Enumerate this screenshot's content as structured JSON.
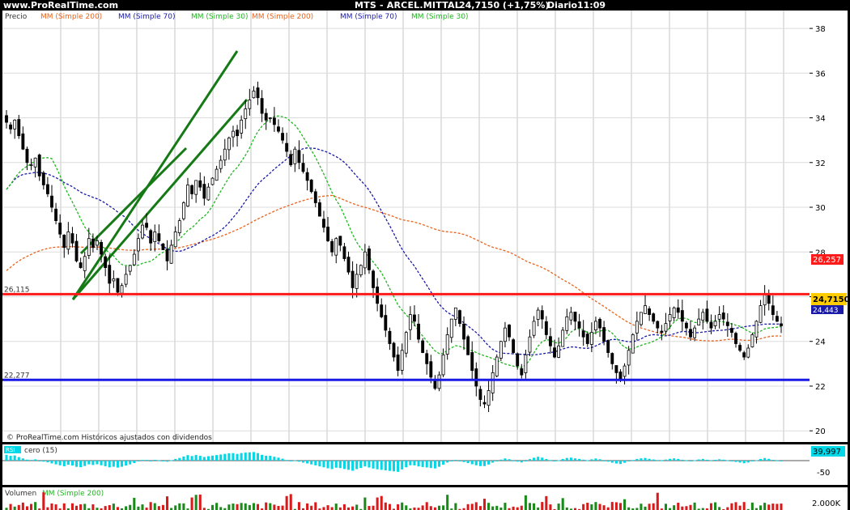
{
  "header": {
    "site": "www.ProRealTime.com",
    "instrument": "MTS - ARCEL.MITTAL",
    "price_change": "24,7150 (+1,75%)",
    "period": "Diario",
    "time": "11:09"
  },
  "legend_main": {
    "price": "Precio",
    "ma200": "MM (Simple 200)",
    "ma70": "MM (Simple 70)",
    "ma30": "MM (Simple 30)",
    "ma200_b": "MM (Simple 200)",
    "ma70_b": "MM (Simple 70)",
    "ma30_b": "MM (Simple 30)"
  },
  "footer_note": "© ProRealTime.com Históricos ajustados con dividendos",
  "colors": {
    "ma200": "#e8641e",
    "ma70": "#1a1aa8",
    "ma30": "#22b522",
    "resistance": "#ff1a1a",
    "support": "#1a1ae6",
    "channel": "#157a15",
    "candle": "#000000",
    "histogram": "#00d8e8",
    "volume_up": "#1a8a1a",
    "volume_down": "#d81a1a"
  },
  "levels": {
    "resistance_label": "26,115",
    "support_label": "22,277",
    "ma200_value_label": "26,257",
    "current_price_label": "24,7150",
    "ma70_value_label": "24,443"
  },
  "oscillator": {
    "title_prefix": "RSI",
    "title": "cero (15)",
    "value_label": "39,997",
    "tick": "-50"
  },
  "volume_panel": {
    "title": "Volumen",
    "ma": "MM (Simple 200)",
    "tick": "2.000K"
  },
  "chart_data": {
    "type": "candlestick",
    "ylim": [
      19.5,
      38.8
    ],
    "yticks": [
      "38",
      "36",
      "34",
      "32",
      "30",
      "28",
      "26",
      "24",
      "22",
      "20"
    ],
    "ytick_values": [
      38,
      36,
      34,
      32,
      30,
      28,
      26,
      24,
      22,
      20
    ],
    "resistance": 26.115,
    "support": 22.277,
    "closes": [
      33.8,
      33.5,
      33.9,
      33.2,
      32.6,
      32.0,
      31.9,
      32.2,
      31.4,
      31.0,
      30.6,
      30.0,
      29.4,
      28.8,
      28.2,
      28.9,
      28.4,
      27.6,
      27.3,
      27.8,
      28.6,
      28.2,
      28.5,
      27.9,
      27.3,
      26.6,
      26.8,
      26.2,
      26.5,
      27.0,
      27.4,
      27.9,
      28.6,
      29.2,
      29.1,
      28.4,
      28.9,
      28.5,
      28.1,
      27.6,
      28.3,
      28.9,
      29.4,
      30.2,
      31.0,
      30.6,
      31.2,
      30.9,
      30.4,
      30.9,
      31.3,
      31.7,
      32.1,
      32.6,
      33.1,
      33.4,
      33.2,
      33.9,
      34.4,
      34.8,
      35.2,
      34.9,
      34.2,
      33.9,
      34.0,
      33.7,
      33.4,
      33.0,
      32.5,
      31.9,
      32.6,
      32.0,
      31.6,
      31.2,
      30.7,
      30.2,
      29.6,
      29.1,
      28.5,
      28.0,
      28.6,
      28.3,
      27.7,
      27.1,
      26.4,
      27.0,
      27.4,
      28.0,
      27.2,
      26.4,
      25.7,
      25.1,
      24.5,
      23.9,
      23.3,
      22.7,
      23.6,
      24.4,
      25.2,
      24.9,
      24.1,
      23.5,
      23.0,
      22.4,
      21.9,
      22.5,
      23.4,
      24.3,
      25.0,
      25.5,
      24.8,
      24.1,
      23.4,
      22.7,
      22.0,
      21.4,
      21.2,
      21.8,
      22.6,
      23.3,
      24.0,
      24.6,
      24.2,
      23.5,
      22.9,
      22.5,
      23.4,
      24.2,
      24.9,
      25.4,
      25.0,
      24.3,
      23.8,
      23.3,
      23.8,
      24.5,
      25.1,
      25.3,
      24.9,
      24.6,
      24.2,
      23.9,
      24.4,
      24.9,
      24.6,
      24.0,
      23.5,
      23.0,
      22.6,
      22.3,
      22.9,
      23.6,
      24.3,
      24.9,
      25.3,
      25.6,
      25.2,
      24.9,
      24.6,
      24.4,
      24.8,
      25.2,
      25.5,
      25.3,
      24.9,
      24.6,
      24.2,
      24.6,
      25.0,
      25.3,
      24.9,
      24.6,
      24.9,
      25.2,
      25.0,
      24.7,
      24.4,
      23.9,
      23.6,
      23.3,
      23.7,
      24.3,
      24.9,
      25.6,
      26.1,
      25.7,
      25.2,
      24.9,
      24.7
    ]
  }
}
